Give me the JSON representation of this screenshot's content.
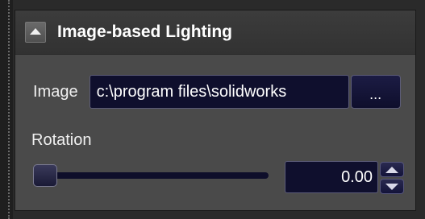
{
  "panel": {
    "title": "Image-based Lighting",
    "collapse_icon": "collapse-up-icon"
  },
  "image_row": {
    "label": "Image",
    "path_value": "c:\\program files\\solidworks",
    "browse_label": "..."
  },
  "rotation": {
    "label": "Rotation",
    "value": "0.00",
    "slider_fraction": 0.0,
    "increment_icon": "spin-up-icon",
    "decrement_icon": "spin-down-icon"
  },
  "colors": {
    "panel_bg": "#4a4a4a",
    "header_bg": "#363636",
    "field_bg": "#0f0f2d",
    "text": "#ffffff"
  }
}
